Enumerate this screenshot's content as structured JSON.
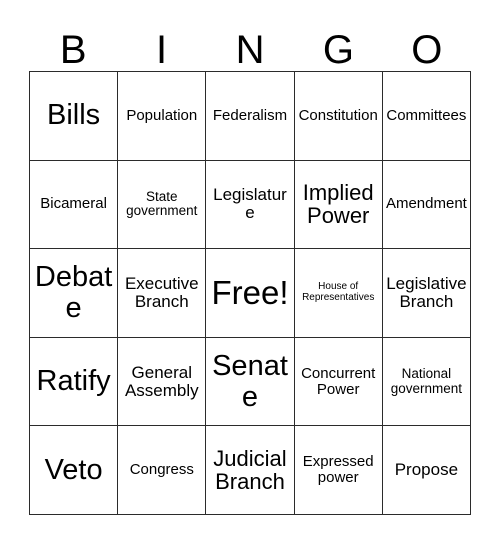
{
  "card": {
    "header_letters": [
      "B",
      "I",
      "N",
      "G",
      "O"
    ],
    "columns": 5,
    "rows": 5,
    "border_color": "#2b2b2b",
    "background_color": "#ffffff",
    "text_color": "#000000",
    "free_space_label": "Free!",
    "free_space_position": {
      "row": 3,
      "column": 3
    }
  },
  "grid": {
    "rows": [
      {
        "cells": [
          {
            "text": "Bills",
            "size": "xl"
          },
          {
            "text": "Population",
            "size": "sm"
          },
          {
            "text": "Federalism",
            "size": "sm"
          },
          {
            "text": "Constitution",
            "size": "sm"
          },
          {
            "text": "Committees",
            "size": "sm"
          }
        ]
      },
      {
        "cells": [
          {
            "text": "Bicameral",
            "size": "sm"
          },
          {
            "text": "State\ngovernment",
            "size": "xs"
          },
          {
            "text": "Legislature",
            "size": "md"
          },
          {
            "text": "Implied\nPower",
            "size": "lg"
          },
          {
            "text": "Amendment",
            "size": "sm"
          }
        ]
      },
      {
        "cells": [
          {
            "text": "Debate",
            "size": "xl"
          },
          {
            "text": "Executive\nBranch",
            "size": "md"
          },
          {
            "text": "Free!",
            "size": "xxl"
          },
          {
            "text": "House of\nRepresentatives",
            "size": "xxs"
          },
          {
            "text": "Legislative\nBranch",
            "size": "md"
          }
        ]
      },
      {
        "cells": [
          {
            "text": "Ratify",
            "size": "xl"
          },
          {
            "text": "General\nAssembly",
            "size": "md"
          },
          {
            "text": "Senate",
            "size": "xl"
          },
          {
            "text": "Concurrent\nPower",
            "size": "sm"
          },
          {
            "text": "National\ngovernment",
            "size": "xs"
          }
        ]
      },
      {
        "cells": [
          {
            "text": "Veto",
            "size": "xl"
          },
          {
            "text": "Congress",
            "size": "sm"
          },
          {
            "text": "Judicial\nBranch",
            "size": "lg"
          },
          {
            "text": "Expressed\npower",
            "size": "sm"
          },
          {
            "text": "Propose",
            "size": "md"
          }
        ]
      }
    ]
  }
}
